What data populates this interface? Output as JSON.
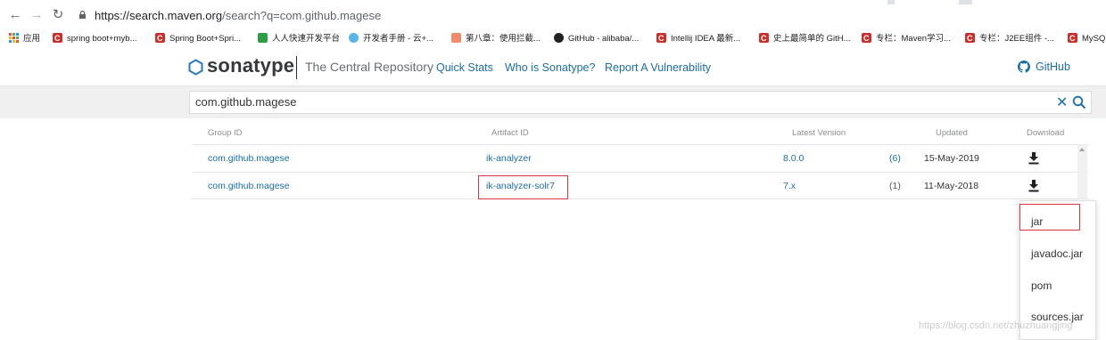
{
  "browser": {
    "url_host": "https://search.maven.org",
    "url_path": "/search?q=com.github.magese",
    "bookmarks": [
      {
        "label": "应用",
        "icon": "apps-grid-icon"
      },
      {
        "label": "spring boot+myb...",
        "icon": "csdn-icon"
      },
      {
        "label": "Spring Boot+Spri...",
        "icon": "csdn-icon"
      },
      {
        "label": "人人快速开发平台",
        "icon": "renren-icon"
      },
      {
        "label": "开发者手册 - 云+...",
        "icon": "cloud-icon"
      },
      {
        "label": "第八章：使用拦截...",
        "icon": "book-icon"
      },
      {
        "label": "GitHub - alibaba/...",
        "icon": "github-icon"
      },
      {
        "label": "Intellij IDEA 最新...",
        "icon": "csdn-icon"
      },
      {
        "label": "史上最简单的 GitH...",
        "icon": "csdn-icon"
      },
      {
        "label": "专栏：Maven学习...",
        "icon": "csdn-icon"
      },
      {
        "label": "专栏：J2EE组件 -...",
        "icon": "csdn-icon"
      },
      {
        "label": "MySQ",
        "icon": "csdn-icon"
      }
    ]
  },
  "header": {
    "logo_text": "sonatype",
    "tagline": "The Central Repository",
    "nav": [
      "Quick Stats",
      "Who is Sonatype?",
      "Report A Vulnerability"
    ],
    "github_label": "GitHub"
  },
  "search": {
    "value": "com.github.magese"
  },
  "results": {
    "columns": [
      "Group ID",
      "Artifact ID",
      "Latest Version",
      "Updated",
      "Download"
    ],
    "rows": [
      {
        "group_id": "com.github.magese",
        "artifact_id": "ik-analyzer",
        "version": "8.0.0",
        "count": "(6)",
        "updated": "15-May-2019"
      },
      {
        "group_id": "com.github.magese",
        "artifact_id": "ik-analyzer-solr7",
        "version": "7.x",
        "count": "(1)",
        "updated": "11-May-2018"
      }
    ]
  },
  "download_menu": {
    "items": [
      "jar",
      "javadoc.jar",
      "pom",
      "sources.jar"
    ]
  },
  "watermark": "https://blog.csdn.net/zhuzhuangjing",
  "colors": {
    "link": "#1a6ea6",
    "highlight": "#d9363e",
    "search_band": "#f0f0f0"
  }
}
